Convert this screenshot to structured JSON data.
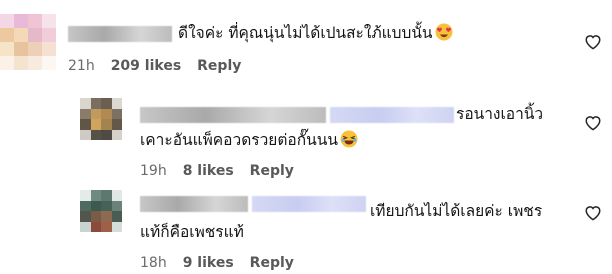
{
  "comments": [
    {
      "text": "ดีใจค่ะ ที่คุณนุ่นไม่ได้เปนสะใภ้แบบนั้น",
      "emoji": "heart-eyes-emoji",
      "time": "21h",
      "likes": "209 likes",
      "reply": "Reply"
    },
    {
      "text_line1": "รอนางเอานิ้ว",
      "text_line2": "เคาะอันแพ็คอวดรวยต่อกั๊นนน",
      "emoji": "laughing-emoji",
      "time": "19h",
      "likes": "8 likes",
      "reply": "Reply"
    },
    {
      "text_line1": "เทียบกันไม่ได้เลยค่ะ เพชร",
      "text_line2": "แท้ก็คือเพชรแท้",
      "time": "18h",
      "likes": "9 likes",
      "reply": "Reply"
    }
  ],
  "icons": {
    "like": "heart-outline-icon"
  },
  "colors": {
    "text": "#141414",
    "meta": "#6b6b6b",
    "heart": "#262626"
  }
}
